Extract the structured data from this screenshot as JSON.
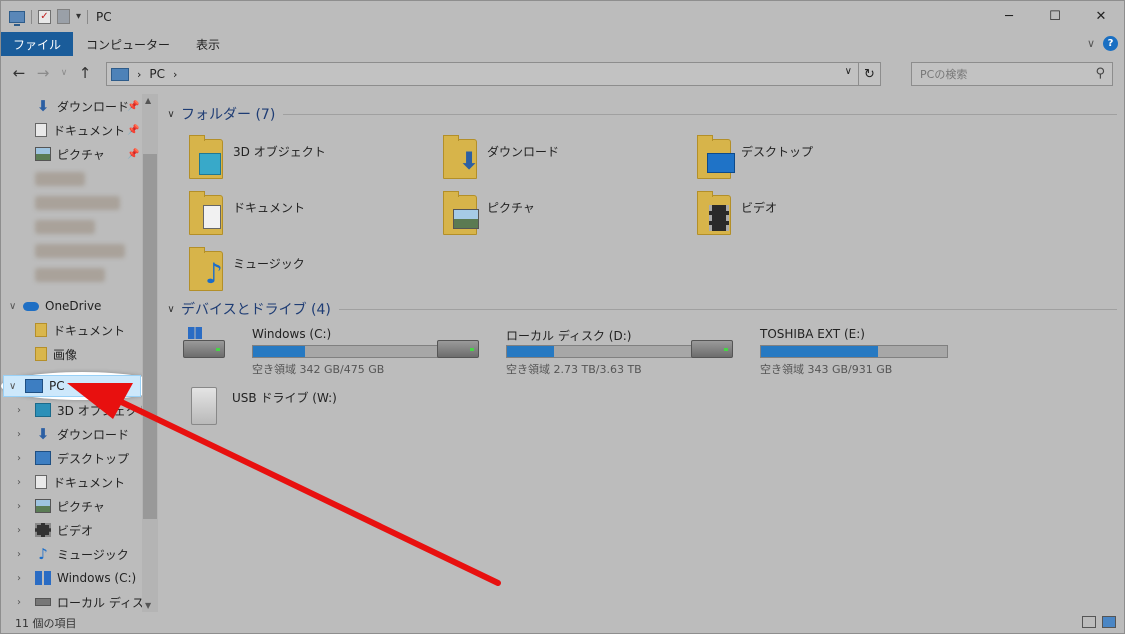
{
  "window": {
    "title": "PC",
    "minimize": "─",
    "maximize": "☐",
    "close": "✕"
  },
  "ribbon": {
    "tabs": [
      "ファイル",
      "コンピューター",
      "表示"
    ]
  },
  "address": {
    "crumb": "PC",
    "search_placeholder": "PCの検索"
  },
  "sidebar": {
    "quick": [
      {
        "label": "ダウンロード",
        "icon": "download-icon"
      },
      {
        "label": "ドキュメント",
        "icon": "document-icon"
      },
      {
        "label": "ピクチャ",
        "icon": "picture-icon"
      }
    ],
    "onedrive": {
      "label": "OneDrive",
      "children": [
        "ドキュメント",
        "画像"
      ]
    },
    "pc": {
      "label": "PC",
      "children": [
        "3D オブジェクト",
        "ダウンロード",
        "デスクトップ",
        "ドキュメント",
        "ピクチャ",
        "ビデオ",
        "ミュージック",
        "Windows (C:)",
        "ローカル ディスク (D"
      ]
    }
  },
  "main": {
    "folders_header": "フォルダー (7)",
    "folders": [
      "3D オブジェクト",
      "ダウンロード",
      "デスクトップ",
      "ドキュメント",
      "ピクチャ",
      "ビデオ",
      "ミュージック"
    ],
    "drives_header": "デバイスとドライブ (4)",
    "drives": [
      {
        "name": "Windows (C:)",
        "capacity": "空き領域 342 GB/475 GB",
        "used_fraction": 0.28
      },
      {
        "name": "ローカル ディスク (D:)",
        "capacity": "空き領域 2.73 TB/3.63 TB",
        "used_fraction": 0.25
      },
      {
        "name": "TOSHIBA EXT (E:)",
        "capacity": "空き領域 343 GB/931 GB",
        "used_fraction": 0.63
      },
      {
        "name": "USB ドライブ (W:)"
      }
    ]
  },
  "status": {
    "count": "11 個の項目"
  },
  "colors": {
    "accent": "#1a5c9a",
    "annotation_arrow": "#e8100f",
    "drive_fill": "#2679c2"
  }
}
